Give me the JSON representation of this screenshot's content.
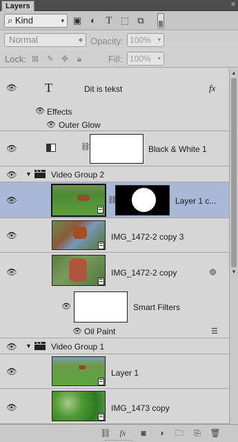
{
  "panel": {
    "tab_label": "Layers",
    "menu_icon": "panel-menu-icon"
  },
  "filter": {
    "kind_label": "Kind",
    "search_icon": "search-icon"
  },
  "blend": {
    "mode": "Normal",
    "opacity_label": "Opacity:",
    "opacity_value": "100%"
  },
  "lock": {
    "label": "Lock:",
    "fill_label": "Fill:",
    "fill_value": "100%"
  },
  "layers": {
    "text_layer": {
      "name": "Dit is tekst",
      "fx": "fx",
      "effects_label": "Effects",
      "outer_glow": "Outer Glow"
    },
    "bw_layer": {
      "name": "Black & White 1"
    },
    "group2": {
      "name": "Video Group 2"
    },
    "layer1c": {
      "name": "Layer 1 c..."
    },
    "img_copy3": {
      "name": "IMG_1472-2 copy 3"
    },
    "img_copy": {
      "name": "IMG_1472-2 copy",
      "smart_filters": "Smart Filters",
      "oil_paint": "Oil Paint"
    },
    "group1": {
      "name": "Video Group 1"
    },
    "layer1": {
      "name": "Layer 1"
    },
    "img1473": {
      "name": "IMG_1473 copy"
    }
  },
  "colors": {
    "selected_row": "#a9b8d6",
    "panel_bg": "#d6d6d6",
    "title_bar": "#4d4d4d"
  }
}
